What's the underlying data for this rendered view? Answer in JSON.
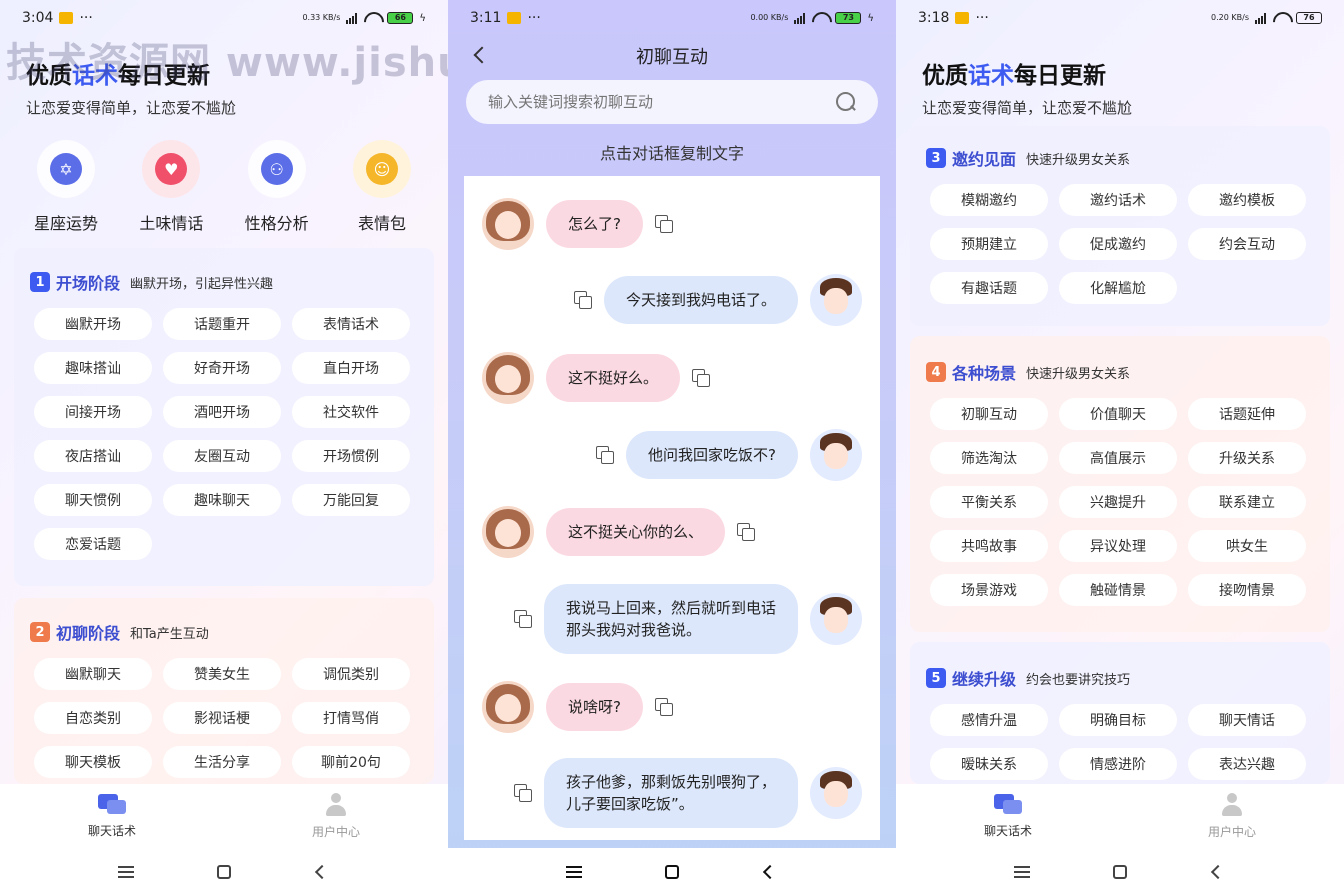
{
  "watermark": "技术资源网 www.jishuziyuan.net",
  "screen1": {
    "status": {
      "time": "3:04",
      "net_speed": "0.33 KB/s",
      "battery": "66"
    },
    "hero": {
      "title_pre": "优质",
      "title_accent": "话术",
      "title_post": "每日更新",
      "subtitle": "让恋爱变得简单，让恋爱不尴尬"
    },
    "shortcuts": [
      {
        "label": "星座运势",
        "icon": "star-of-david-icon",
        "color": "#5b6ee8"
      },
      {
        "label": "土味情话",
        "icon": "hearts-icon",
        "color": "#f0506a"
      },
      {
        "label": "性格分析",
        "icon": "people-icon",
        "color": "#5b6ee8"
      },
      {
        "label": "表情包",
        "icon": "smiley-icon",
        "color": "#f5b62a"
      }
    ],
    "cards": [
      {
        "num": "1",
        "title": "开场阶段",
        "subtitle": "幽默开场，引起异性兴趣",
        "tags": [
          "幽默开场",
          "话题重开",
          "表情话术",
          "趣味搭讪",
          "好奇开场",
          "直白开场",
          "间接开场",
          "酒吧开场",
          "社交软件",
          "夜店搭讪",
          "友圈互动",
          "开场惯例",
          "聊天惯例",
          "趣味聊天",
          "万能回复",
          "恋爱话题"
        ]
      },
      {
        "num": "2",
        "title": "初聊阶段",
        "subtitle": "和Ta产生互动",
        "tags": [
          "幽默聊天",
          "赞美女生",
          "调侃类别",
          "自恋类别",
          "影视话梗",
          "打情骂俏",
          "聊天模板",
          "生活分享",
          "聊前20句"
        ]
      }
    ],
    "tabbar": {
      "tab1": "聊天话术",
      "tab2": "用户中心"
    }
  },
  "screen2": {
    "status": {
      "time": "3:11",
      "net_speed": "0.00 KB/s",
      "battery": "73"
    },
    "title": "初聊互动",
    "search_placeholder": "输入关键词搜索初聊互动",
    "hint": "点击对话框复制文字",
    "messages": [
      {
        "side": "left",
        "text": "怎么了?"
      },
      {
        "side": "right",
        "text": "今天接到我妈电话了。"
      },
      {
        "side": "left",
        "text": "这不挺好么。"
      },
      {
        "side": "right",
        "text": "他问我回家吃饭不?"
      },
      {
        "side": "left",
        "text": "这不挺关心你的么、"
      },
      {
        "side": "right",
        "text": "我说马上回来，然后就听到电话那头我妈对我爸说。"
      },
      {
        "side": "left",
        "text": "说啥呀?"
      },
      {
        "side": "right",
        "text": "孩子他爹，那剩饭先别喂狗了，儿子要回家吃饭”。"
      }
    ]
  },
  "screen3": {
    "status": {
      "time": "3:18",
      "net_speed": "0.20 KB/s",
      "battery": "76"
    },
    "hero": {
      "title_pre": "优质",
      "title_accent": "话术",
      "title_post": "每日更新",
      "subtitle": "让恋爱变得简单，让恋爱不尴尬"
    },
    "cards": [
      {
        "num": "3",
        "title": "邀约见面",
        "subtitle": "快速升级男女关系",
        "tags": [
          "模糊邀约",
          "邀约话术",
          "邀约模板",
          "预期建立",
          "促成邀约",
          "约会互动",
          "有趣话题",
          "化解尴尬"
        ]
      },
      {
        "num": "4",
        "title": "各种场景",
        "subtitle": "快速升级男女关系",
        "tags": [
          "初聊互动",
          "价值聊天",
          "话题延伸",
          "筛选淘汰",
          "高值展示",
          "升级关系",
          "平衡关系",
          "兴趣提升",
          "联系建立",
          "共鸣故事",
          "异议处理",
          "哄女生",
          "场景游戏",
          "触碰情景",
          "接吻情景"
        ]
      },
      {
        "num": "5",
        "title": "继续升级",
        "subtitle": "约会也要讲究技巧",
        "tags": [
          "感情升温",
          "明确目标",
          "聊天情话",
          "暧昧关系",
          "情感进阶",
          "表达兴趣"
        ]
      }
    ],
    "tabbar": {
      "tab1": "聊天话术",
      "tab2": "用户中心"
    }
  }
}
